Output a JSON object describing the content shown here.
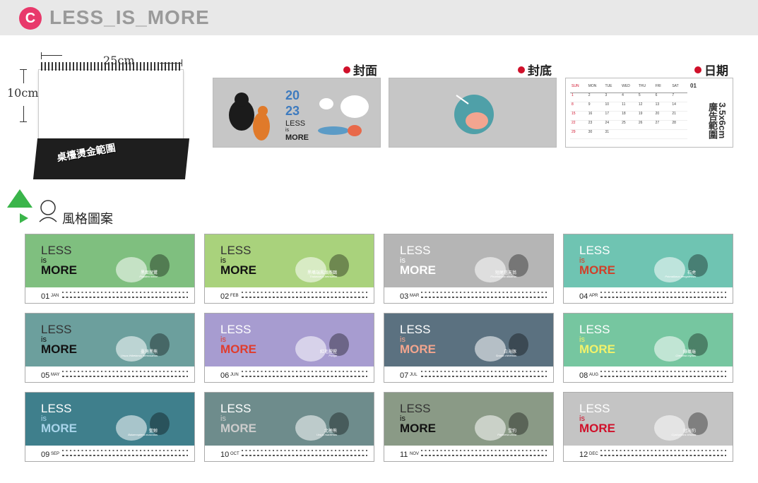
{
  "header": {
    "badge": "C",
    "title": "LESS_IS_MORE"
  },
  "desk": {
    "width_label": "25cm",
    "height_label": "10cm",
    "base_label": "桌檯燙金範圍"
  },
  "previews": [
    {
      "label": "封面",
      "bg": "#c6c6c6"
    },
    {
      "label": "封底",
      "bg": "#c6c6c6"
    },
    {
      "label": "日期",
      "bg": "#ffffff"
    }
  ],
  "date_page": {
    "month": "01",
    "size_label": "3.5x6cm",
    "ad_label": "廣告範圍"
  },
  "cover": {
    "year_top": "20",
    "year_bottom": "23",
    "less": "LESS",
    "is": "is",
    "more": "MORE"
  },
  "style_section": {
    "title": "風格圖案"
  },
  "months": [
    {
      "num": "01",
      "mon": "JAN",
      "name": "黑面琵鷺",
      "sci": "Platalea minor",
      "bg": "#7fbf7f",
      "more_color": "#111111"
    },
    {
      "num": "02",
      "mon": "FEB",
      "name": "黑嘴端鳳頭燕鷗",
      "sci": "Thalasseus bernsteini",
      "bg": "#a9d27c",
      "more_color": "#111111"
    },
    {
      "num": "03",
      "mon": "MAR",
      "name": "短尾信天翁",
      "sci": "Phoebastria albatrus",
      "bg": "#b5b5b5",
      "more_color": "#ffffff"
    },
    {
      "num": "04",
      "mon": "APR",
      "name": "石虎",
      "sci": "Prionailurus bengalensis",
      "bg": "#6fc4b2",
      "more_color": "#d0402a"
    },
    {
      "num": "05",
      "mon": "MAY",
      "name": "臺灣黑熊",
      "sci": "Ursus thibetanus formosanus",
      "bg": "#6c9f9d",
      "more_color": "#111111"
    },
    {
      "num": "06",
      "mon": "JUN",
      "name": "紅毛猩猩",
      "sci": "Pongo",
      "bg": "#a79cd0",
      "more_color": "#e03c2d"
    },
    {
      "num": "07",
      "mon": "JUL",
      "name": "白海豚",
      "sci": "Sousa chinensis",
      "bg": "#5b7180",
      "more_color": "#f3a58e"
    },
    {
      "num": "08",
      "mon": "AUG",
      "name": "綠蠵龜",
      "sci": "Chelonia mydas",
      "bg": "#76c6a0",
      "more_color": "#f2f26a"
    },
    {
      "num": "09",
      "mon": "SEP",
      "name": "藍鯨",
      "sci": "Balaenoptera musculus",
      "bg": "#3f7f8c",
      "more_color": "#a8d4ea"
    },
    {
      "num": "10",
      "mon": "OCT",
      "name": "北極熊",
      "sci": "Ursus maritimus",
      "bg": "#6e8c8c",
      "more_color": "#cccccc"
    },
    {
      "num": "11",
      "mon": "NOV",
      "name": "雪豹",
      "sci": "Panthera uncia",
      "bg": "#8a9a86",
      "more_color": "#111111"
    },
    {
      "num": "12",
      "mon": "DEC",
      "name": "冠海豹",
      "sci": "Cystophora cristata",
      "bg": "#c4c4c4",
      "more_color": "#d0102a"
    }
  ]
}
